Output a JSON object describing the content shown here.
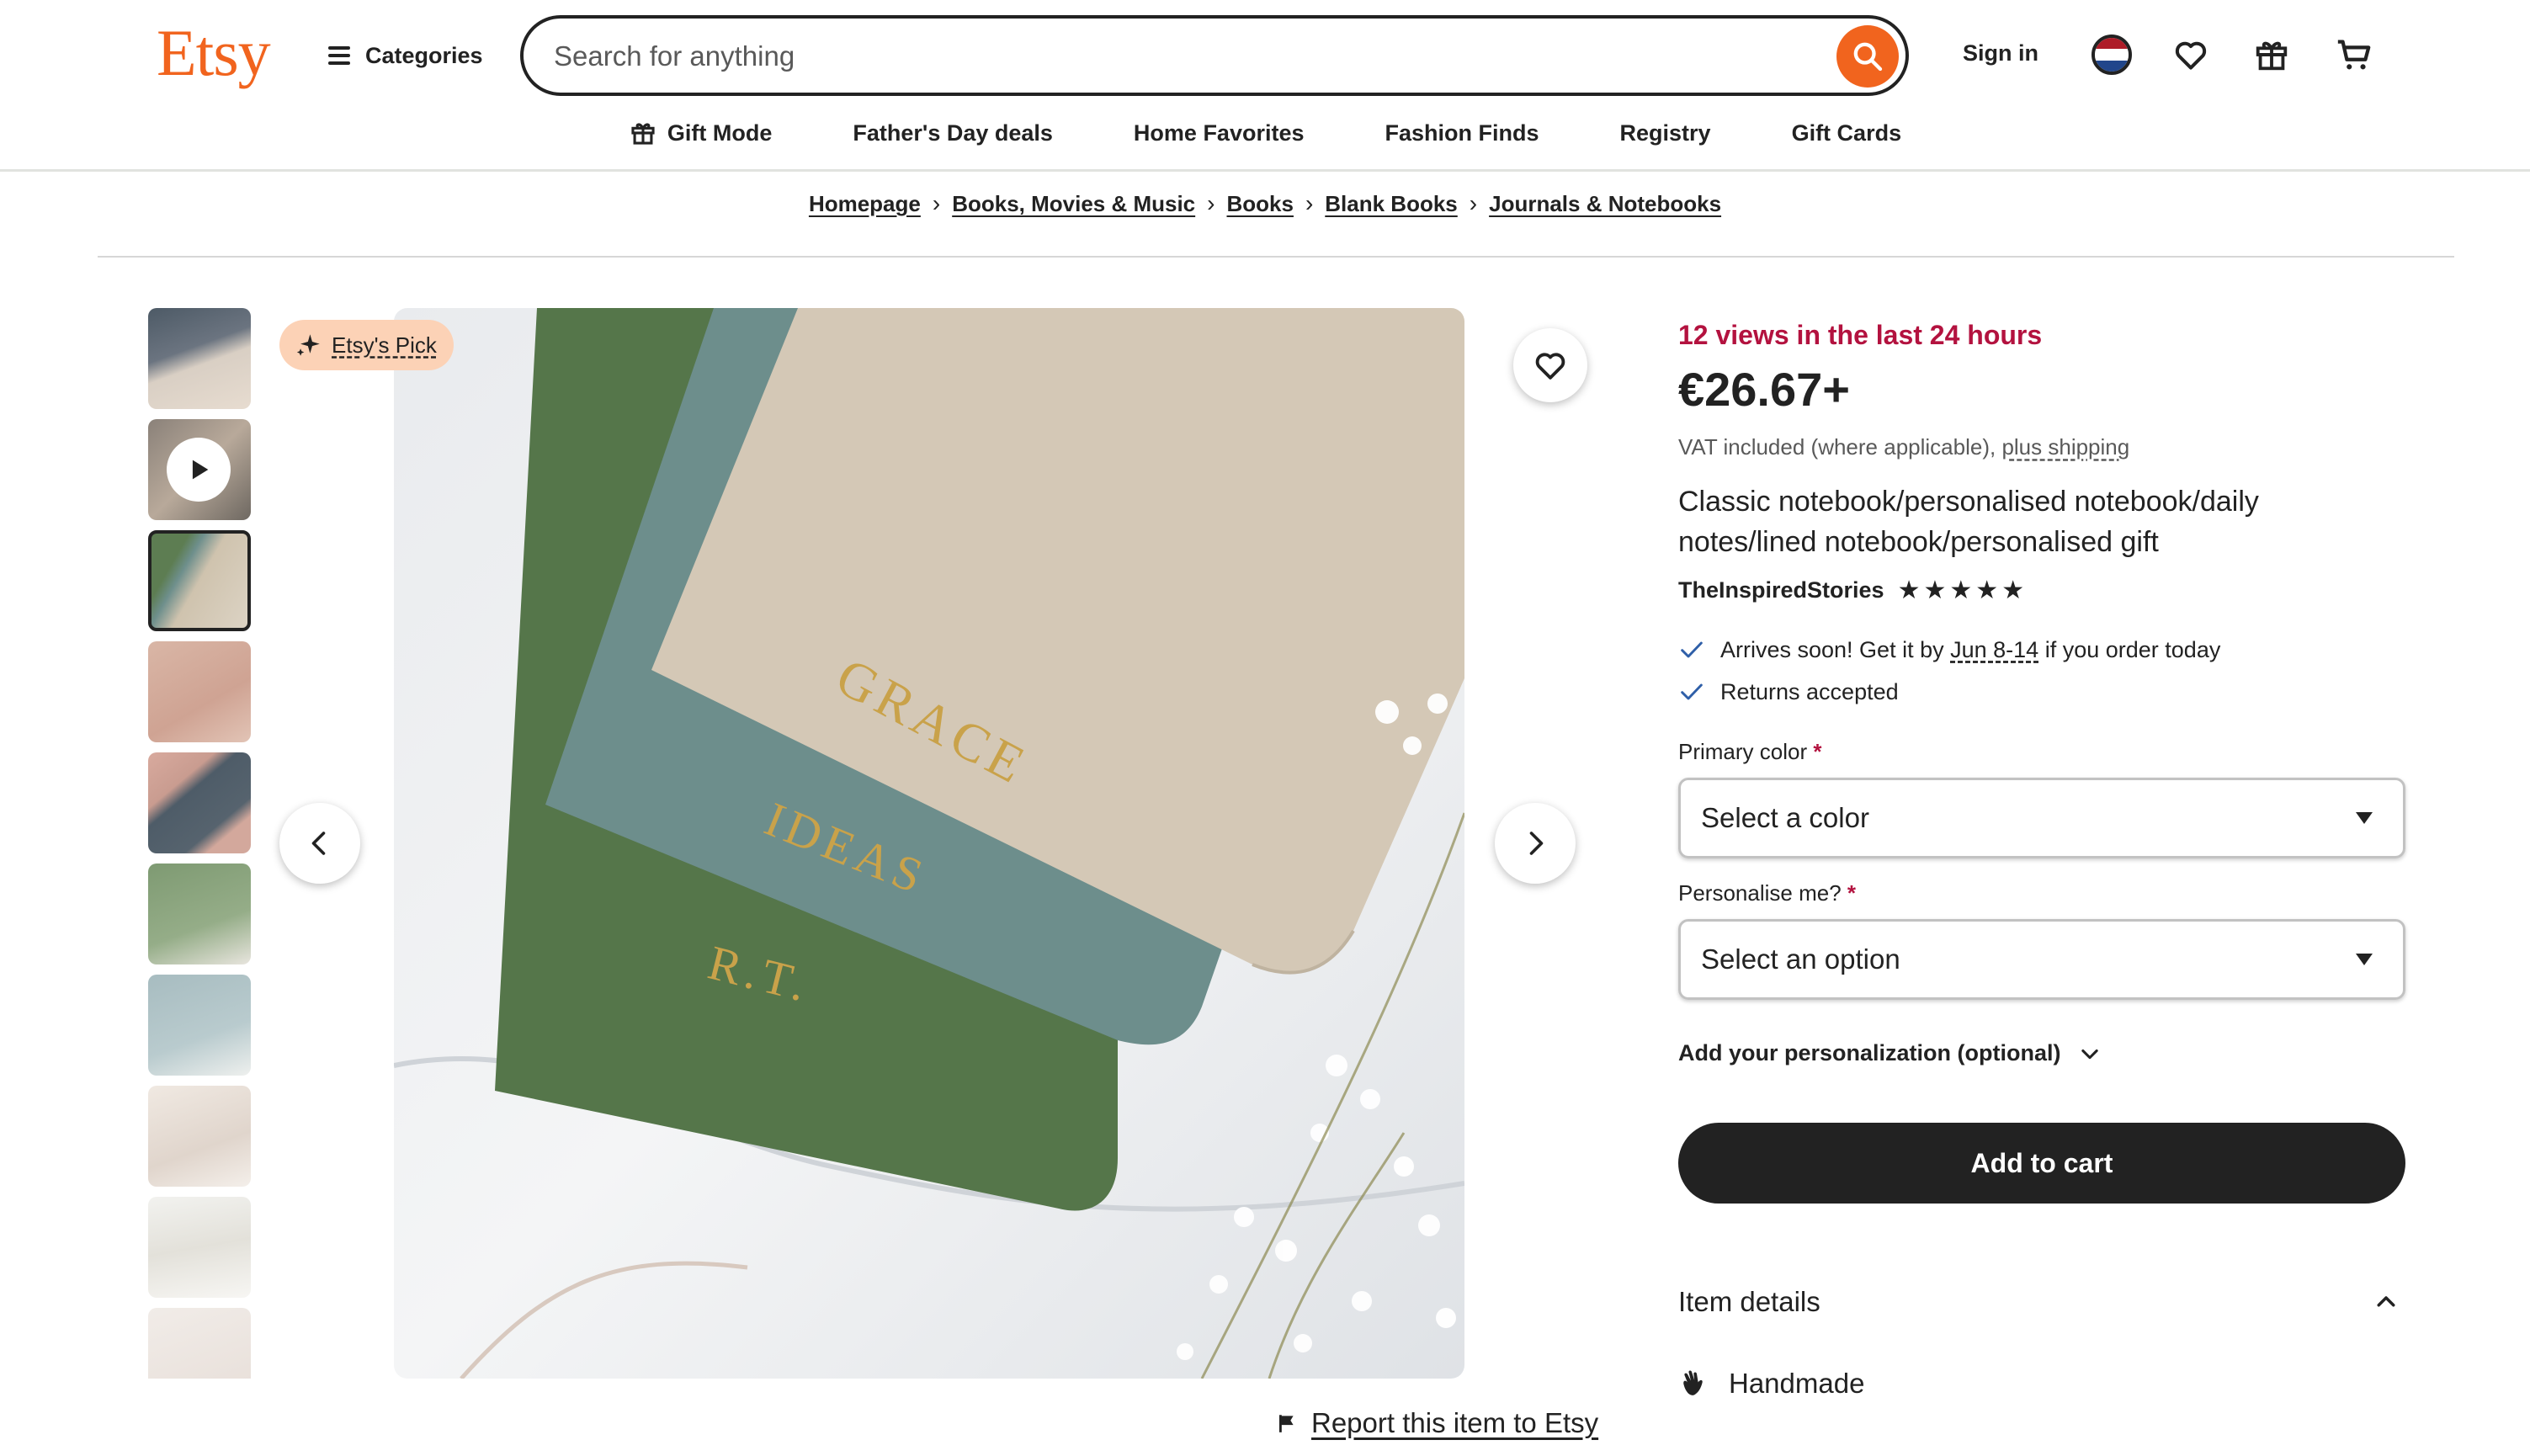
{
  "header": {
    "logo": "Etsy",
    "categories_label": "Categories",
    "search_placeholder": "Search for anything",
    "sign_in": "Sign in",
    "icons": [
      "flag-icon",
      "heart-icon",
      "gift-icon",
      "cart-icon"
    ]
  },
  "subnav": [
    {
      "label": "Gift Mode",
      "icon": "gift-icon"
    },
    {
      "label": "Father's Day deals"
    },
    {
      "label": "Home Favorites"
    },
    {
      "label": "Fashion Finds"
    },
    {
      "label": "Registry"
    },
    {
      "label": "Gift Cards"
    }
  ],
  "breadcrumb": [
    "Homepage",
    "Books, Movies & Music",
    "Books",
    "Blank Books",
    "Journals & Notebooks"
  ],
  "gallery": {
    "badge": "Etsy's Pick",
    "thumbnail_count": 10,
    "active_index": 2,
    "notebook_labels": [
      "GRACE",
      "IDEAS",
      "R.T."
    ]
  },
  "report_link": "Report this item to Etsy",
  "listing": {
    "views": "12 views in the last 24 hours",
    "price": "€26.67+",
    "vat_text": "VAT included (where applicable),",
    "shipping_link": "plus shipping",
    "title": "Classic notebook/personalised notebook/daily notes/lined notebook/personalised gift",
    "shop_name": "TheInspiredStories",
    "rating": 5,
    "arrives_pre": "Arrives soon! Get it by",
    "arrives_dates": "Jun 8-14",
    "arrives_post": "if you order today",
    "returns": "Returns accepted",
    "color_label": "Primary color",
    "color_value": "Select a color",
    "personalise_label": "Personalise me?",
    "personalise_value": "Select an option",
    "required_mark": "*",
    "personalization_toggle": "Add your personalization (optional)",
    "add_to_cart": "Add to cart",
    "item_details": "Item details",
    "handmade": "Handmade"
  },
  "colors": {
    "brand": "#f1641e",
    "views_red": "#b3123f",
    "badge_bg": "#fcd2b6",
    "cart_button": "#222222"
  }
}
